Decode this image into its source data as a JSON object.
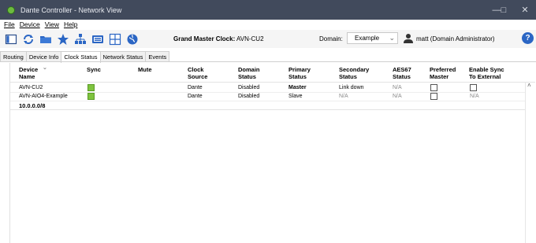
{
  "window": {
    "title": "Dante Controller - Network View"
  },
  "menu": [
    "File",
    "Device",
    "View",
    "Help"
  ],
  "toolbar": {
    "grand_master_label": "Grand Master Clock:",
    "grand_master_value": "AVN-CU2",
    "domain_label": "Domain:",
    "domain_value": "Example",
    "user_label": "matt (Domain Administrator)",
    "help": "?"
  },
  "tabs": [
    "Routing",
    "Device Info",
    "Clock Status",
    "Network Status",
    "Events"
  ],
  "active_tab": "Clock Status",
  "columns": [
    [
      "Device",
      "Name"
    ],
    [
      "Sync",
      ""
    ],
    [
      "Mute",
      ""
    ],
    [
      "Clock",
      "Source"
    ],
    [
      "Domain",
      "Status"
    ],
    [
      "Primary",
      "Status"
    ],
    [
      "Secondary",
      "Status"
    ],
    [
      "AES67",
      "Status"
    ],
    [
      "Preferred",
      "Master"
    ],
    [
      "Enable Sync",
      "To External"
    ]
  ],
  "rows": [
    {
      "name": "AVN-CU2",
      "clock_source": "Dante",
      "domain_status": "Disabled",
      "primary_status": "Master",
      "secondary_status": "Link down",
      "aes67": "N/A",
      "enable_sync": ""
    },
    {
      "name": "AVN-AIO4-Example",
      "clock_source": "Dante",
      "domain_status": "Disabled",
      "primary_status": "Slave",
      "secondary_status": "N/A",
      "aes67": "N/A",
      "enable_sync": "N/A"
    }
  ],
  "subnet": "10.0.0.0/8",
  "colors": {
    "titlebar": "#414a5c",
    "sync_ok": "#7ec33e",
    "help": "#2b66c4"
  }
}
